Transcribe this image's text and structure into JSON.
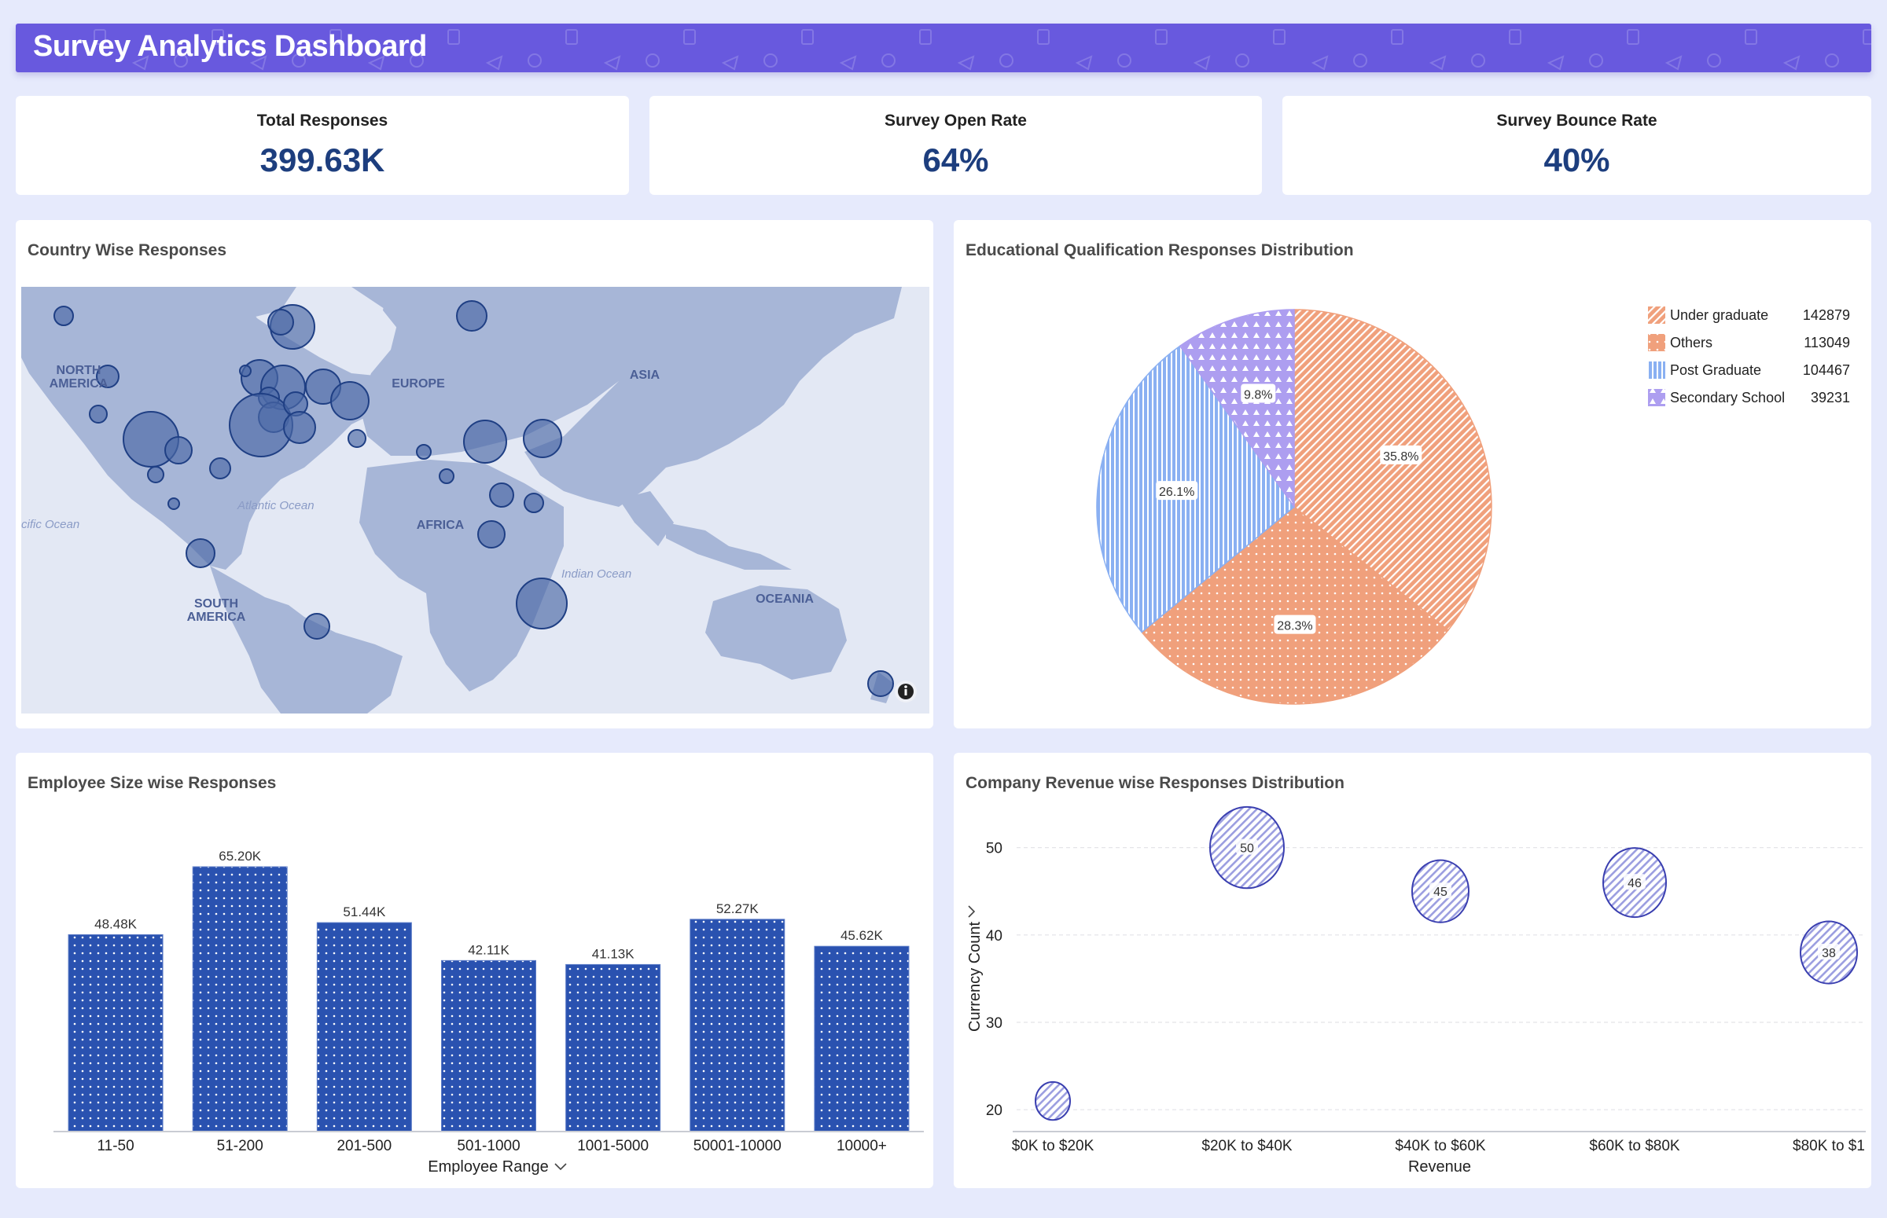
{
  "header": {
    "title": "Survey Analytics Dashboard"
  },
  "kpis": [
    {
      "label": "Total Responses",
      "value": "399.63K"
    },
    {
      "label": "Survey Open Rate",
      "value": "64%"
    },
    {
      "label": "Survey Bounce Rate",
      "value": "40%"
    }
  ],
  "map": {
    "title": "Country Wise Responses",
    "labels": {
      "north_america": [
        "NORTH",
        "AMERICA"
      ],
      "south_america": [
        "SOUTH",
        "AMERICA"
      ],
      "europe": "EUROPE",
      "africa": "AFRICA",
      "asia": "ASIA",
      "oceania": "OCEANIA",
      "atlantic": "Atlantic Ocean",
      "pacific": "cific Ocean",
      "indian": "Indian Ocean"
    },
    "info_icon": "info-icon"
  },
  "pie": {
    "title": "Educational Qualification Responses Distribution"
  },
  "bar": {
    "title": "Employee Size wise Responses"
  },
  "bubble": {
    "title": "Company Revenue wise Responses Distribution"
  },
  "colors": {
    "header": "#6859de",
    "kpi_value": "#1d3e7e",
    "bar": "#2a52b0",
    "under_graduate": "#f0a07c",
    "others": "#f0a07c",
    "post_graduate": "#8ab0f2",
    "secondary_school": "#ad9ef0",
    "bubble": "#3a3fb0",
    "map_land": "#a7b6d7",
    "map_water": "#e3e8f4",
    "map_bubble": "#4b68a6"
  },
  "chart_data": [
    {
      "type": "pie",
      "title": "Educational Qualification Responses Distribution",
      "legend_position": "top-right",
      "slices": [
        {
          "label": "Under graduate",
          "value": 142879,
          "percent": "35.8%"
        },
        {
          "label": "Others",
          "value": 113049,
          "percent": "28.3%"
        },
        {
          "label": "Post Graduate",
          "value": 104467,
          "percent": "26.1%"
        },
        {
          "label": "Secondary School",
          "value": 39231,
          "percent": "9.8%"
        }
      ]
    },
    {
      "type": "bar",
      "title": "Employee Size wise Responses",
      "xlabel": "Employee Range",
      "ylabel": "",
      "categories": [
        "11-50",
        "51-200",
        "201-500",
        "501-1000",
        "1001-5000",
        "50001-10000",
        "10000+"
      ],
      "values": [
        48480,
        65200,
        51440,
        42110,
        41130,
        52270,
        45620
      ],
      "data_labels": [
        "48.48K",
        "65.20K",
        "51.44K",
        "42.11K",
        "41.13K",
        "52.27K",
        "45.62K"
      ],
      "ylim": [
        0,
        70000
      ],
      "grid": false
    },
    {
      "type": "scatter",
      "subtype": "bubble",
      "title": "Company Revenue wise Responses Distribution",
      "xlabel": "Revenue",
      "ylabel": "Currency Count",
      "categories": [
        "$0K to $20K",
        "$20K to $40K",
        "$40K to $60K",
        "$60K to $80K",
        "$80K to $1"
      ],
      "values": [
        21,
        50,
        45,
        46,
        38
      ],
      "data_labels": [
        "",
        "50",
        "45",
        "46",
        "38"
      ],
      "yticks": [
        20,
        30,
        40,
        50
      ],
      "ylim": [
        17.5,
        55
      ],
      "grid": true
    },
    {
      "type": "scatter",
      "subtype": "geo-bubble",
      "title": "Country Wise Responses",
      "regions": [
        "NORTH AMERICA",
        "SOUTH AMERICA",
        "EUROPE",
        "AFRICA",
        "ASIA",
        "OCEANIA"
      ]
    }
  ]
}
